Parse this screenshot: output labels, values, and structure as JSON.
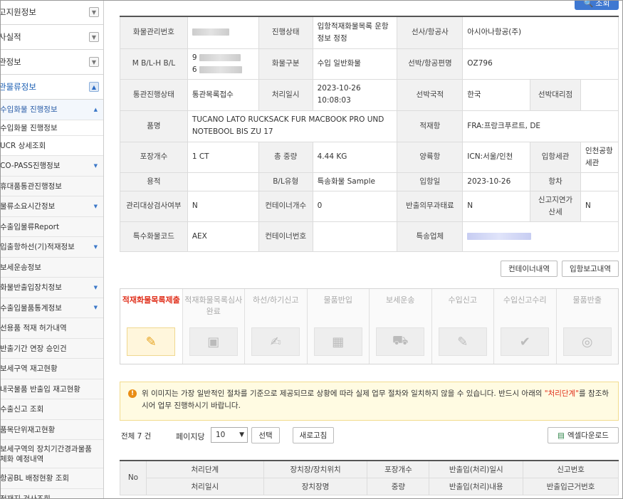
{
  "sidebar": {
    "groups": [
      {
        "label": "고지원정보"
      },
      {
        "label": "사실적"
      },
      {
        "label": "관정보"
      },
      {
        "label": "관물류정보"
      }
    ],
    "items": [
      {
        "label": "수입화물 진행정보"
      },
      {
        "label": "수입화물 진행정보"
      },
      {
        "label": "UCR 상세조회"
      },
      {
        "label": "CO-PASS진행정보"
      },
      {
        "label": "휴대품통관진행정보"
      },
      {
        "label": "물류소요시간정보"
      },
      {
        "label": "수출입물류Report"
      },
      {
        "label": "입출항하선(기)적재정보"
      },
      {
        "label": "보세운송정보"
      },
      {
        "label": "화물반출입장치정보"
      },
      {
        "label": "수출입물품통계정보"
      },
      {
        "label": "선용품 적재 허가내역"
      },
      {
        "label": "반출기간 연장 승인건"
      },
      {
        "label": "보세구역 재고현황"
      },
      {
        "label": "내국물품 반출입 재고현황"
      },
      {
        "label": "수출신고 조회"
      },
      {
        "label": "품목단위재고현황"
      },
      {
        "label": "보세구역의 장치기간경과물품 체화 예정내역"
      },
      {
        "label": "항공BL 배정현황 조회"
      },
      {
        "label": "적재지 검사조회"
      }
    ]
  },
  "top_button": {
    "label": "조회"
  },
  "info": {
    "cargo_no_label": "화물관리번호",
    "status_label": "진행상태",
    "status_value": "입항적재화물목록 운항정보 정정",
    "carrier_label": "선사/항공사",
    "carrier_value": "아시아나항공(주)",
    "bl_label": "M B/L-H B/L",
    "bl_prefix1": "9",
    "bl_prefix2": "6",
    "cargo_type_label": "화물구분",
    "cargo_type_value": "수입 일반화물",
    "flight_label": "선박/항공편명",
    "flight_value": "OZ796",
    "customs_status_label": "통관진행상태",
    "customs_status_value": "통관목록접수",
    "processed_label": "처리일시",
    "processed_value": "2023-10-26 10:08:03",
    "nationality_label": "선박국적",
    "nationality_value": "한국",
    "agent_label": "선박대리점",
    "item_label": "품명",
    "item_value": "TUCANO LATO RUCKSACK FUR MACBOOK PRO UND NOTEBOOL BIS ZU 17",
    "loading_port_label": "적재항",
    "loading_port_value": "FRA:프랑크푸르트, DE",
    "pkg_label": "포장개수",
    "pkg_value": "1 CT",
    "weight_label": "총 중량",
    "weight_value": "4.44 KG",
    "unload_port_label": "양륙항",
    "unload_port_value": "ICN:서울/인천",
    "entry_customs_label": "입항세관",
    "entry_customs_value": "인천공항세관",
    "usage_label": "용적",
    "bl_type_label": "B/L유형",
    "bl_type_value": "특송화물 Sample",
    "entry_date_label": "입항일",
    "entry_date_value": "2023-10-26",
    "voyage_label": "항차",
    "inspect_label": "관리대상검사여부",
    "inspect_value": "N",
    "container_count_label": "컨테이너개수",
    "container_count_value": "0",
    "export_obl_label": "반출의무과태료",
    "export_obl_value": "N",
    "late_report_label": "신고지연가산세",
    "late_report_value": "N",
    "special_code_label": "특수화물코드",
    "special_code_value": "AEX",
    "container_no_label": "컨테이너번호",
    "courier_label": "특송업체"
  },
  "buttons": {
    "container": "컨테이너내역",
    "entry_report": "입항보고내역"
  },
  "steps": [
    {
      "label": "적재화물목록제출",
      "current": true
    },
    {
      "label": "적재화물목록심사완료"
    },
    {
      "label": "하선/하기신고"
    },
    {
      "label": "물품반입"
    },
    {
      "label": "보세운송"
    },
    {
      "label": "수입신고"
    },
    {
      "label": "수입신고수리"
    },
    {
      "label": "물품반출"
    }
  ],
  "notice": {
    "text1": "위 이미지는 가장 일반적인 절차를 기준으로 제공되므로 상황에 따라 실제 업무 절차와 일치하지 않을 수 있습니다. 반드시 아래의 ",
    "highlight": "\"처리단계\"",
    "text2": "를 참조하시어 업무 진행하시기 바랍니다."
  },
  "toolbar": {
    "total": "전체 7 건",
    "per_page_label": "페이지당",
    "per_page_value": "10",
    "select_button": "선택",
    "refresh_button": "새로고침",
    "excel_button": "엑셀다운로드"
  },
  "progress_table": {
    "no": "No",
    "row1": [
      "처리단계",
      "장치장/장치위치",
      "포장개수",
      "반출입(처리)일시",
      "신고번호"
    ],
    "row2": [
      "처리일시",
      "장치장명",
      "중량",
      "반출입(처리)내용",
      "반출입근거번호"
    ]
  },
  "colors": {
    "accent": "#3f78d1",
    "highlight_red": "#e0311d",
    "notice_bg": "#fffbe2"
  }
}
